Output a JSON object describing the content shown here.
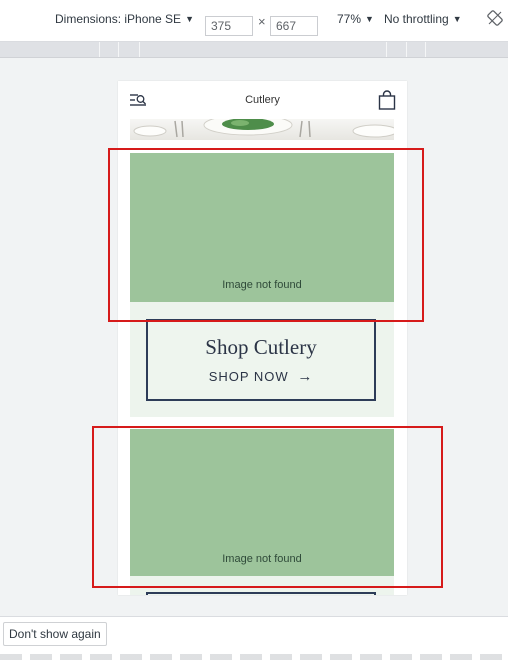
{
  "devtools": {
    "dimensions_label": "Dimensions: iPhone SE",
    "dimensions_caret": "▼",
    "width": "375",
    "times": "×",
    "height": "667",
    "zoom": "77%",
    "zoom_caret": "▼",
    "throttle": "No throttling",
    "throttle_caret": "▼",
    "rotate_icon": "rotate-icon"
  },
  "site": {
    "title": "Cutlery",
    "menu_icon": "menu-search-icon",
    "bag_icon": "shopping-bag-icon"
  },
  "tiles": [
    {
      "image_caption": "Image not found",
      "cta_title": "Shop Cutlery",
      "cta_link": "SHOP NOW",
      "cta_arrow": "→"
    },
    {
      "image_caption": "Image not found"
    }
  ],
  "infobar": {
    "dont_show_label": "Don't show again"
  },
  "colors": {
    "highlight": "#d61a1a",
    "image_placeholder": "#9dc49b",
    "tile_background": "#edf4ed",
    "cta_border": "#2d3c58"
  }
}
